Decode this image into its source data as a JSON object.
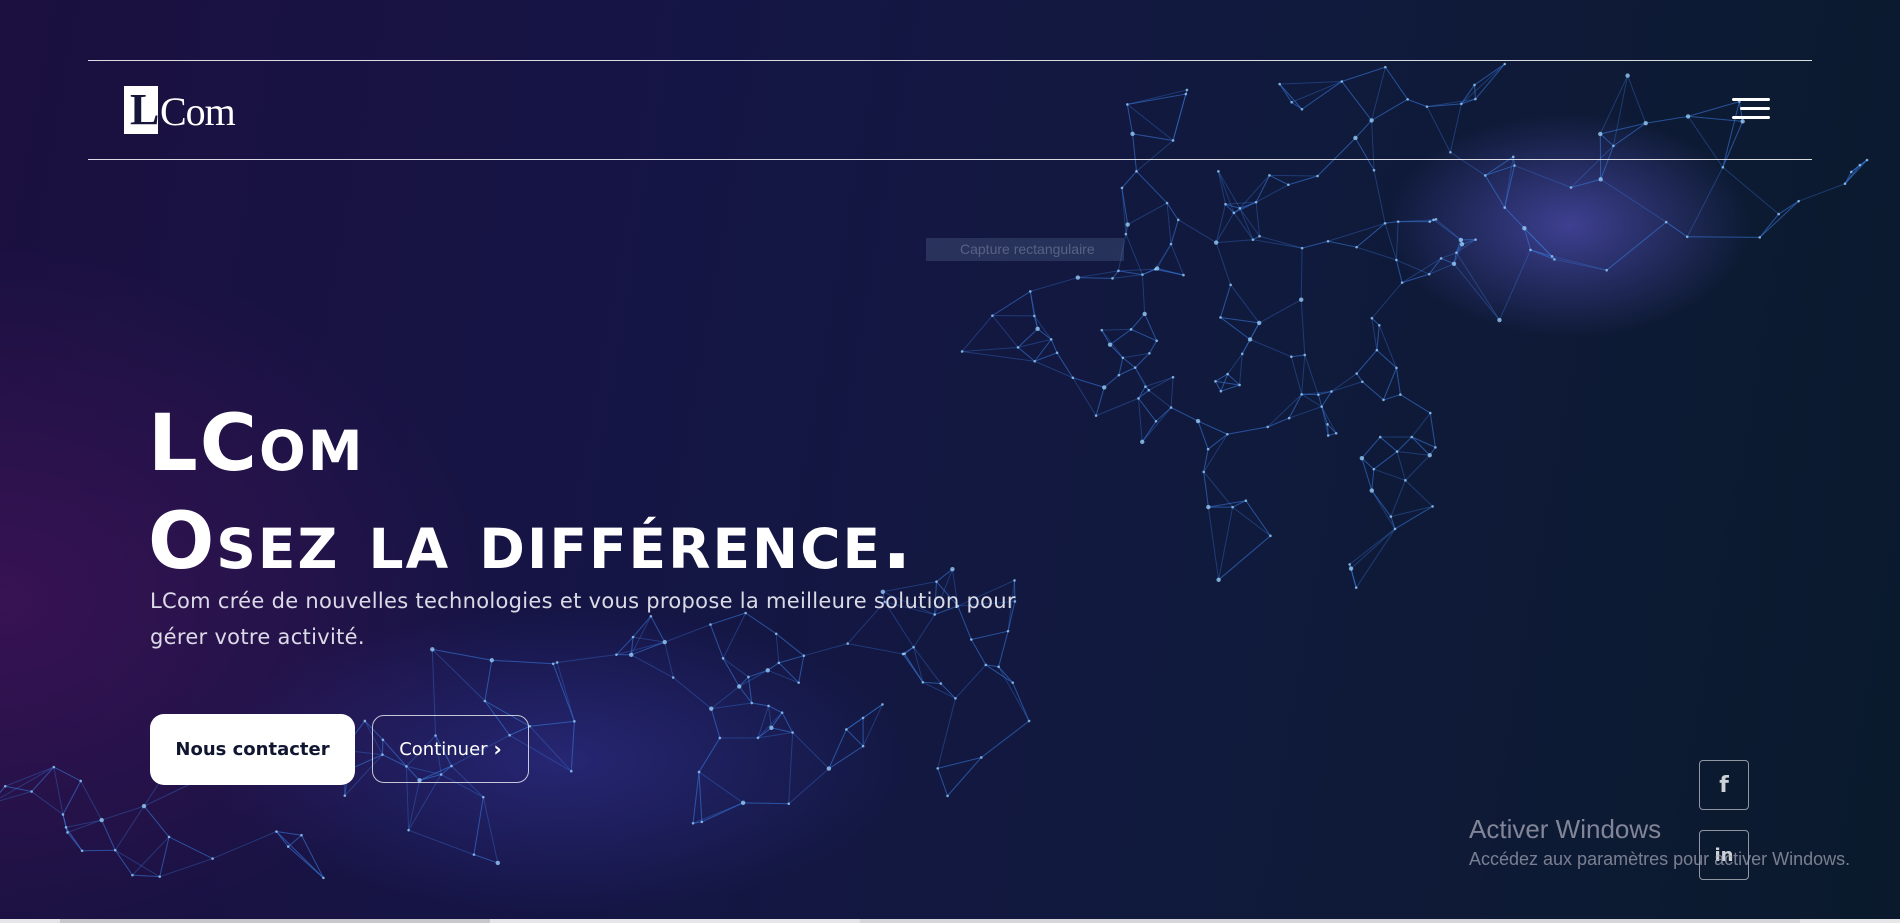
{
  "header": {
    "logo_letter": "L",
    "logo_text": "Com"
  },
  "capture_tooltip": "Capture rectangulaire",
  "hero": {
    "headline_line1": "LCom",
    "headline_line2": "Osez la différence.",
    "subtitle_line1": "LCom crée de nouvelles technologies et vous propose la meilleure solution pour",
    "subtitle_line2": "gérer votre activité.",
    "primary_button": "Nous contacter",
    "secondary_button": "Continuer",
    "secondary_icon": "chevron-right-icon"
  },
  "social": {
    "facebook_glyph": "f",
    "linkedin_glyph": "in"
  },
  "watermark": {
    "title": "Activer Windows",
    "subtitle": "Accédez aux paramètres pour activer Windows."
  },
  "colors": {
    "background": "#101a3c",
    "mesh": "#3a7ae0",
    "button_bg": "#ffffff",
    "button_text": "#101530"
  }
}
